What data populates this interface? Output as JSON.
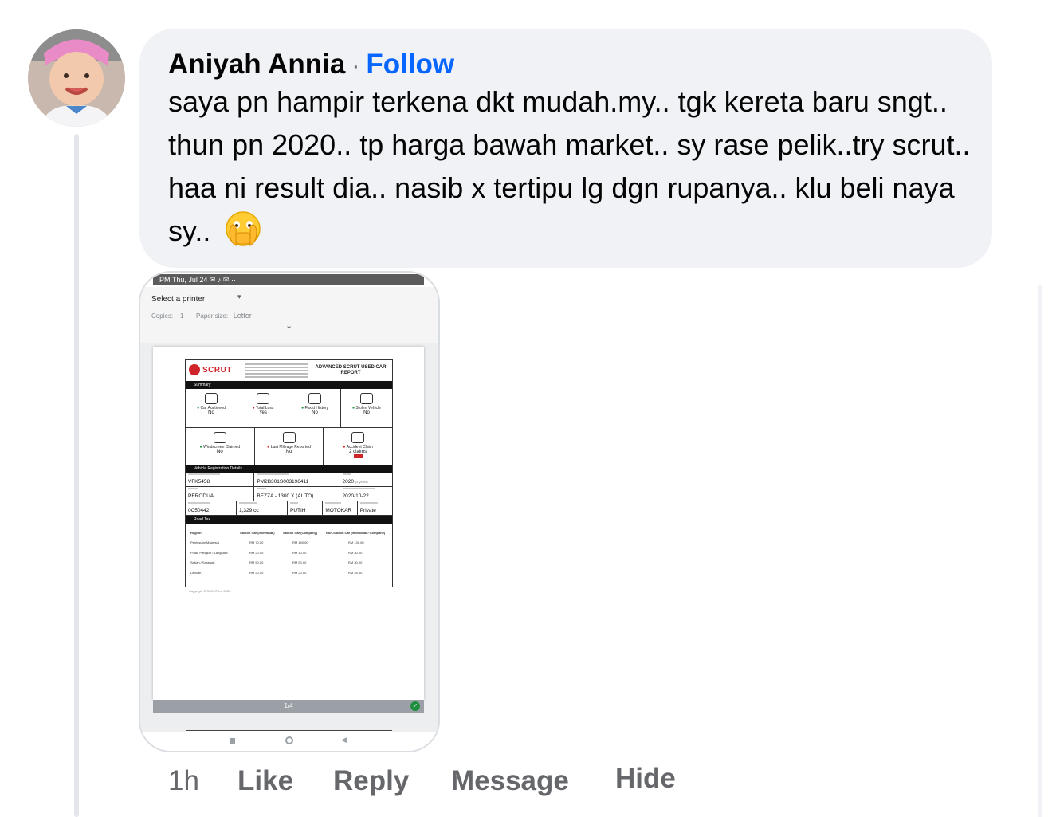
{
  "comment": {
    "author": "Aniyah Annia",
    "separator": "·",
    "follow_label": "Follow",
    "text": "saya pn hampir terkena dkt mudah.my.. tgk kereta baru sngt.. thun pn 2020.. tp harga bawah market.. sy rase pelik..try scrut.. haa ni result dia.. nasib x tertipu lg dgn rupanya.. klu beli naya sy..",
    "emoji_icon": "face-with-open-eyes-and-hand-over-mouth-icon",
    "avatar_icon": "baby-avatar-icon"
  },
  "attachment": {
    "status_bar": "PM  Thu, Jul 24  ✉  ♪  ✉  ···",
    "printer_label": "Select a printer",
    "caret": "▾",
    "copies_label": "Copies:",
    "copies_value": "1",
    "paper_label": "Paper size:",
    "paper_value": "Letter",
    "chevron": "⌄",
    "page_indicator": "1/4",
    "check": "✓",
    "back": "◀",
    "report": {
      "brand": "SCRUT",
      "title": "ADVANCED SCRUT USED CAR REPORT",
      "summary_label": "Summary",
      "checks_row1": [
        {
          "label": "Car Auctioned",
          "value": "No",
          "status": "ok"
        },
        {
          "label": "Total Loss",
          "value": "Yes",
          "status": "bad"
        },
        {
          "label": "Flood History",
          "value": "No",
          "status": "ok"
        },
        {
          "label": "Stolen Vehicle",
          "value": "No",
          "status": "ok"
        }
      ],
      "checks_row2": [
        {
          "label": "Windscreen Claimed",
          "value": "No",
          "status": "ok"
        },
        {
          "label": "Last Mileage Reported",
          "value": "No",
          "status": "bad"
        },
        {
          "label": "Accident Claim",
          "value": "2 claims",
          "status": "bad"
        }
      ],
      "reg_label": "Vehicle Registration Details",
      "reg_no": "VFK5458",
      "chassis": "PM2B301S003196411",
      "year": "2020",
      "year_note": "(5 years)",
      "make": "PERODUA",
      "model": "BEZZA - 1300 X (AUTO)",
      "reg_date": "2020-10-22",
      "engine": "0C50442",
      "capacity": "1,329 cc",
      "colour": "PUTIH",
      "vehicle_type": "MOTOKAR",
      "usage": "Private",
      "roadtax_label": "Road Tax",
      "table_headers": [
        "Region",
        "Saloon Car (Individual)",
        "Saloon Car (Company)",
        "Non-Saloon Car (Individual / Company)"
      ],
      "table_rows": [
        [
          "Peninsular Malaysia",
          "RM 70.00",
          "RM 140.00",
          "RM 130.00"
        ],
        [
          "Pulau Pangkor / Langkawi",
          "RM 20.00",
          "RM 10.00",
          "RM 30.00"
        ],
        [
          "Sabah / Sarawak",
          "RM 50.00",
          "RM 50.00",
          "RM 30.00"
        ],
        [
          "Labuan",
          "RM 20.00",
          "RM 20.00",
          "RM 25.00"
        ]
      ],
      "copyright": "Copyright © SCRUT Inc 2025"
    }
  },
  "actions": {
    "time": "1h",
    "like": "Like",
    "reply": "Reply",
    "message": "Message",
    "hide": "Hide"
  }
}
